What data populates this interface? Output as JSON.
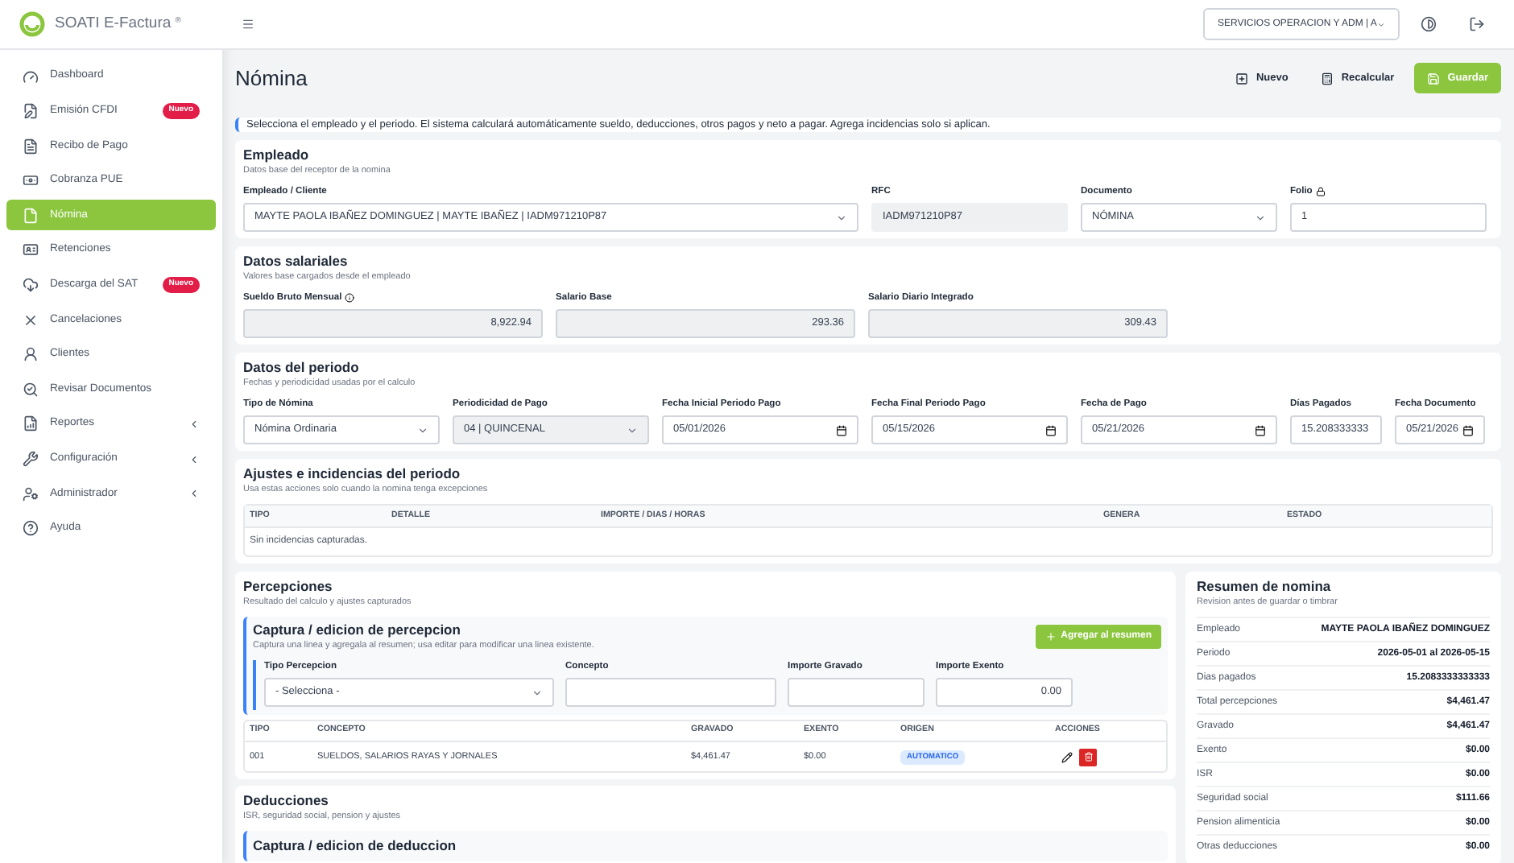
{
  "app": {
    "brand": "SOATI E-Factura",
    "brand_mark": "®"
  },
  "sidebar": {
    "items": [
      {
        "label": "Dashboard",
        "selected": false,
        "expandable": false
      },
      {
        "label": "Emisión CFDI",
        "selected": false,
        "badge": "Nuevo",
        "expandable": false
      },
      {
        "label": "Recibo de Pago",
        "selected": false,
        "expandable": false
      },
      {
        "label": "Cobranza PUE",
        "selected": false,
        "expandable": false
      },
      {
        "label": "Nómina",
        "selected": true,
        "expandable": false
      },
      {
        "label": "Retenciones",
        "selected": false,
        "expandable": false
      },
      {
        "label": "Descarga del SAT",
        "selected": false,
        "badge": "Nuevo",
        "expandable": false
      },
      {
        "label": "Cancelaciones",
        "selected": false,
        "expandable": false
      },
      {
        "label": "Clientes",
        "selected": false,
        "expandable": false
      },
      {
        "label": "Revisar Documentos",
        "selected": false,
        "expandable": false
      },
      {
        "label": "Reportes",
        "selected": false,
        "expandable": true
      },
      {
        "label": "Configuración",
        "selected": false,
        "expandable": true
      },
      {
        "label": "Administrador",
        "selected": false,
        "expandable": true
      },
      {
        "label": "Ayuda",
        "selected": false,
        "expandable": false
      }
    ]
  },
  "header": {
    "company": "SERVICIOS OPERACION Y ADM | A"
  },
  "page": {
    "title": "Nómina",
    "actions": [
      {
        "label": "Nuevo",
        "kind": "plain"
      },
      {
        "label": "Recalcular",
        "kind": "plain"
      },
      {
        "label": "Guardar",
        "kind": "primary"
      }
    ],
    "info": "Selecciona el empleado y el periodo. El sistema calculará automáticamente sueldo, deducciones, otros pagos y neto a pagar. Agrega incidencias solo si aplican."
  },
  "empleado": {
    "title": "Empleado",
    "subtitle": "Datos base del receptor de la nomina",
    "fields": [
      {
        "label": "Empleado / Cliente",
        "value": "MAYTE PAOLA IBAÑEZ DOMINGUEZ | MAYTE IBAÑEZ | IADM971210P87",
        "kind": "select"
      },
      {
        "label": "RFC",
        "value": "IADM971210P87",
        "kind": "readonly"
      },
      {
        "label": "Documento",
        "value": "NÓMINA",
        "kind": "select"
      },
      {
        "label": "Folio",
        "value": "1",
        "kind": "text"
      }
    ]
  },
  "salariales": {
    "title": "Datos salariales",
    "subtitle": "Valores base cargados desde el empleado",
    "fields": [
      {
        "label": "Sueldo Bruto Mensual",
        "value": "8,922.94",
        "kind": "readonly_number"
      },
      {
        "label": "Salario Base",
        "value": "293.36",
        "kind": "readonly_number"
      },
      {
        "label": "Salario Diario Integrado",
        "value": "309.43",
        "kind": "readonly_number"
      }
    ]
  },
  "periodo": {
    "title": "Datos del periodo",
    "subtitle": "Fechas y periodicidad usadas por el calculo",
    "fields": [
      {
        "label": "Tipo de Nómina",
        "value": "Nómina Ordinaria",
        "kind": "select"
      },
      {
        "label": "Periodicidad de Pago",
        "value": "04 | QUINCENAL",
        "kind": "select_disabled"
      },
      {
        "label": "Fecha Inicial Periodo Pago",
        "value": "05/01/2026",
        "kind": "date"
      },
      {
        "label": "Fecha Final Periodo Pago",
        "value": "05/15/2026",
        "kind": "date"
      },
      {
        "label": "Fecha de Pago",
        "value": "05/21/2026",
        "kind": "date"
      },
      {
        "label": "Días Pagados",
        "value": "15.208333333",
        "kind": "text"
      },
      {
        "label": "Fecha Documento",
        "value": "05/21/2026",
        "kind": "date"
      }
    ]
  },
  "ajustes": {
    "title": "Ajustes e incidencias del periodo",
    "subtitle": "Usa estas acciones solo cuando la nomina tenga excepciones",
    "columns": [
      "TIPO",
      "DETALLE",
      "IMPORTE / DIAS / HORAS",
      "GENERA",
      "ESTADO"
    ],
    "empty": "Sin incidencias capturadas."
  },
  "percepciones": {
    "title": "Percepciones",
    "subtitle": "Resultado del calculo y ajustes capturados",
    "capture": {
      "title": "Captura / edicion de percepcion",
      "subtitle": "Captura una linea y agregala al resumen; usa editar para modificar una linea existente.",
      "button": "Agregar al resumen",
      "fields": [
        {
          "label": "Tipo Percepcion",
          "value": "- Selecciona -",
          "kind": "select"
        },
        {
          "label": "Concepto",
          "kind": "text"
        },
        {
          "label": "Importe Gravado",
          "kind": "text"
        },
        {
          "label": "Importe Exento",
          "value": "0.00",
          "kind": "number"
        }
      ]
    },
    "columns": [
      "TIPO",
      "CONCEPTO",
      "GRAVADO",
      "EXENTO",
      "ORIGEN",
      "ACCIONES"
    ],
    "rows": [
      {
        "tipo": "001",
        "concepto": "SUELDOS, SALARIOS RAYAS Y JORNALES",
        "gravado": "$4,461.47",
        "exento": "$0.00",
        "origen": "AUTOMATICO"
      }
    ]
  },
  "deducciones": {
    "title": "Deducciones",
    "subtitle": "ISR, seguridad social, pension y ajustes",
    "capture_title": "Captura / edicion de deduccion"
  },
  "resumen": {
    "title": "Resumen de nomina",
    "subtitle": "Revision antes de guardar o timbrar",
    "rows": [
      {
        "label": "Empleado",
        "value": "MAYTE PAOLA IBAÑEZ DOMINGUEZ"
      },
      {
        "label": "Periodo",
        "value": "2026-05-01 al 2026-05-15"
      },
      {
        "label": "Dias pagados",
        "value": "15.2083333333333"
      },
      {
        "label": "Total percepciones",
        "value": "$4,461.47"
      },
      {
        "label": "Gravado",
        "value": "$4,461.47"
      },
      {
        "label": "Exento",
        "value": "$0.00"
      },
      {
        "label": "ISR",
        "value": "$0.00"
      },
      {
        "label": "Seguridad social",
        "value": "$111.66"
      },
      {
        "label": "Pension alimenticia",
        "value": "$0.00"
      },
      {
        "label": "Otras deducciones",
        "value": "$0.00"
      }
    ]
  }
}
